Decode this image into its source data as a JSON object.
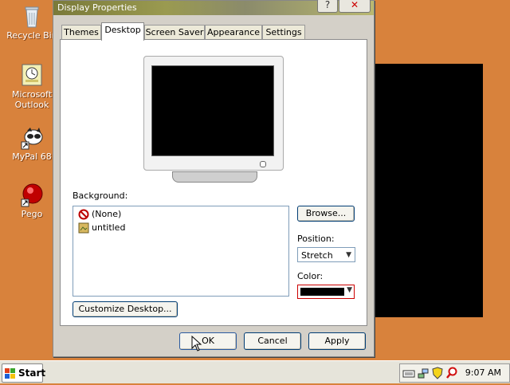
{
  "desktop": {
    "icons": [
      {
        "label": "Recycle Bin",
        "icon": "recycle-bin-icon"
      },
      {
        "label": "Microsoft Outlook",
        "icon": "outlook-icon"
      },
      {
        "label": "MyPal 68",
        "icon": "mypal-icon"
      },
      {
        "label": "Pego",
        "icon": "pego-icon"
      }
    ]
  },
  "window": {
    "title": "Display Properties",
    "tabs": [
      {
        "label": "Themes"
      },
      {
        "label": "Desktop"
      },
      {
        "label": "Screen Saver"
      },
      {
        "label": "Appearance"
      },
      {
        "label": "Settings"
      }
    ],
    "active_tab": "Desktop",
    "background": {
      "label": "Background:",
      "items": [
        {
          "label": "(None)",
          "icon": "none-icon"
        },
        {
          "label": "untitled",
          "icon": "image-file-icon"
        }
      ]
    },
    "browse_label": "Browse...",
    "position": {
      "label": "Position:",
      "value": "Stretch"
    },
    "color": {
      "label": "Color:",
      "value": "#000000"
    },
    "customize_label": "Customize Desktop...",
    "ok_label": "OK",
    "cancel_label": "Cancel",
    "apply_label": "Apply"
  },
  "taskbar": {
    "start_label": "Start",
    "clock": "9:07 AM"
  }
}
